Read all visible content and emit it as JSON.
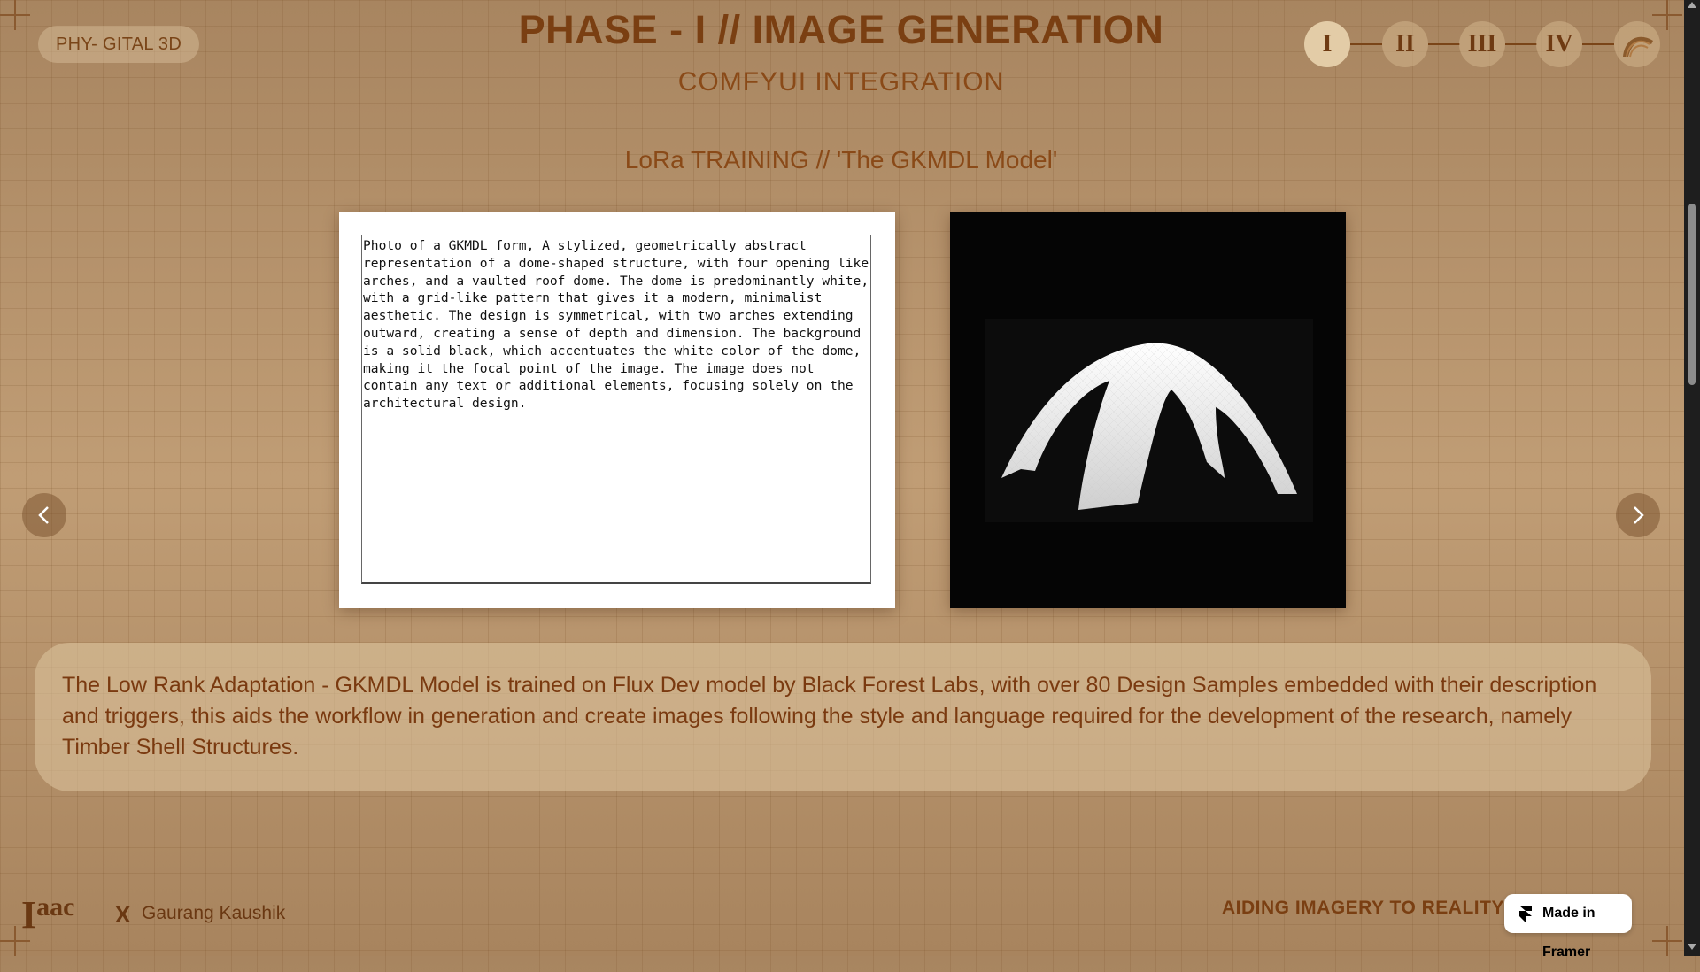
{
  "brand": {
    "label": "PHY- GITAL 3D"
  },
  "header": {
    "title": "PHASE - I // IMAGE GENERATION",
    "subtitle": "COMFYUI INTEGRATION"
  },
  "section": {
    "title": "LoRa TRAINING // 'The GKMDL Model'"
  },
  "phase_nav": {
    "items": [
      "I",
      "II",
      "III",
      "IV"
    ],
    "active": "I",
    "last_icon": "shell-icon"
  },
  "prompt_text": "Photo of a GKMDL form, A stylized, geometrically abstract representation of a dome-shaped structure, with four opening like arches, and a vaulted roof dome. The dome is predominantly white, with a grid-like pattern that gives it a modern, minimalist aesthetic. The design is symmetrical, with two arches extending outward, creating a sense of depth and dimension. The background is a solid black, which accentuates the white color of the dome, making it the focal point of the image. The image does not contain any text or additional elements, focusing solely on the architectural design.",
  "description": "The Low Rank Adaptation - GKMDL Model is trained on Flux Dev model by Black Forest  Labs, with over 80 Design Samples embedded with their description and triggers, this aids the workflow in generation and create images following the style and language required for the development of the research, namely Timber Shell Structures.",
  "footer": {
    "logo_main": "I",
    "logo_small": "aac",
    "separator": "X",
    "author": "Gaurang Kaushik",
    "tagline": "AIDING IMAGERY TO REALITY"
  },
  "framer_badge": {
    "label": "Made in Framer"
  },
  "nav_arrows": {
    "prev": "‹",
    "next": "›"
  },
  "colors": {
    "background": "#b8956e",
    "title": "#7a3f12",
    "card": "#dec6a0",
    "image_bg": "#050505"
  }
}
